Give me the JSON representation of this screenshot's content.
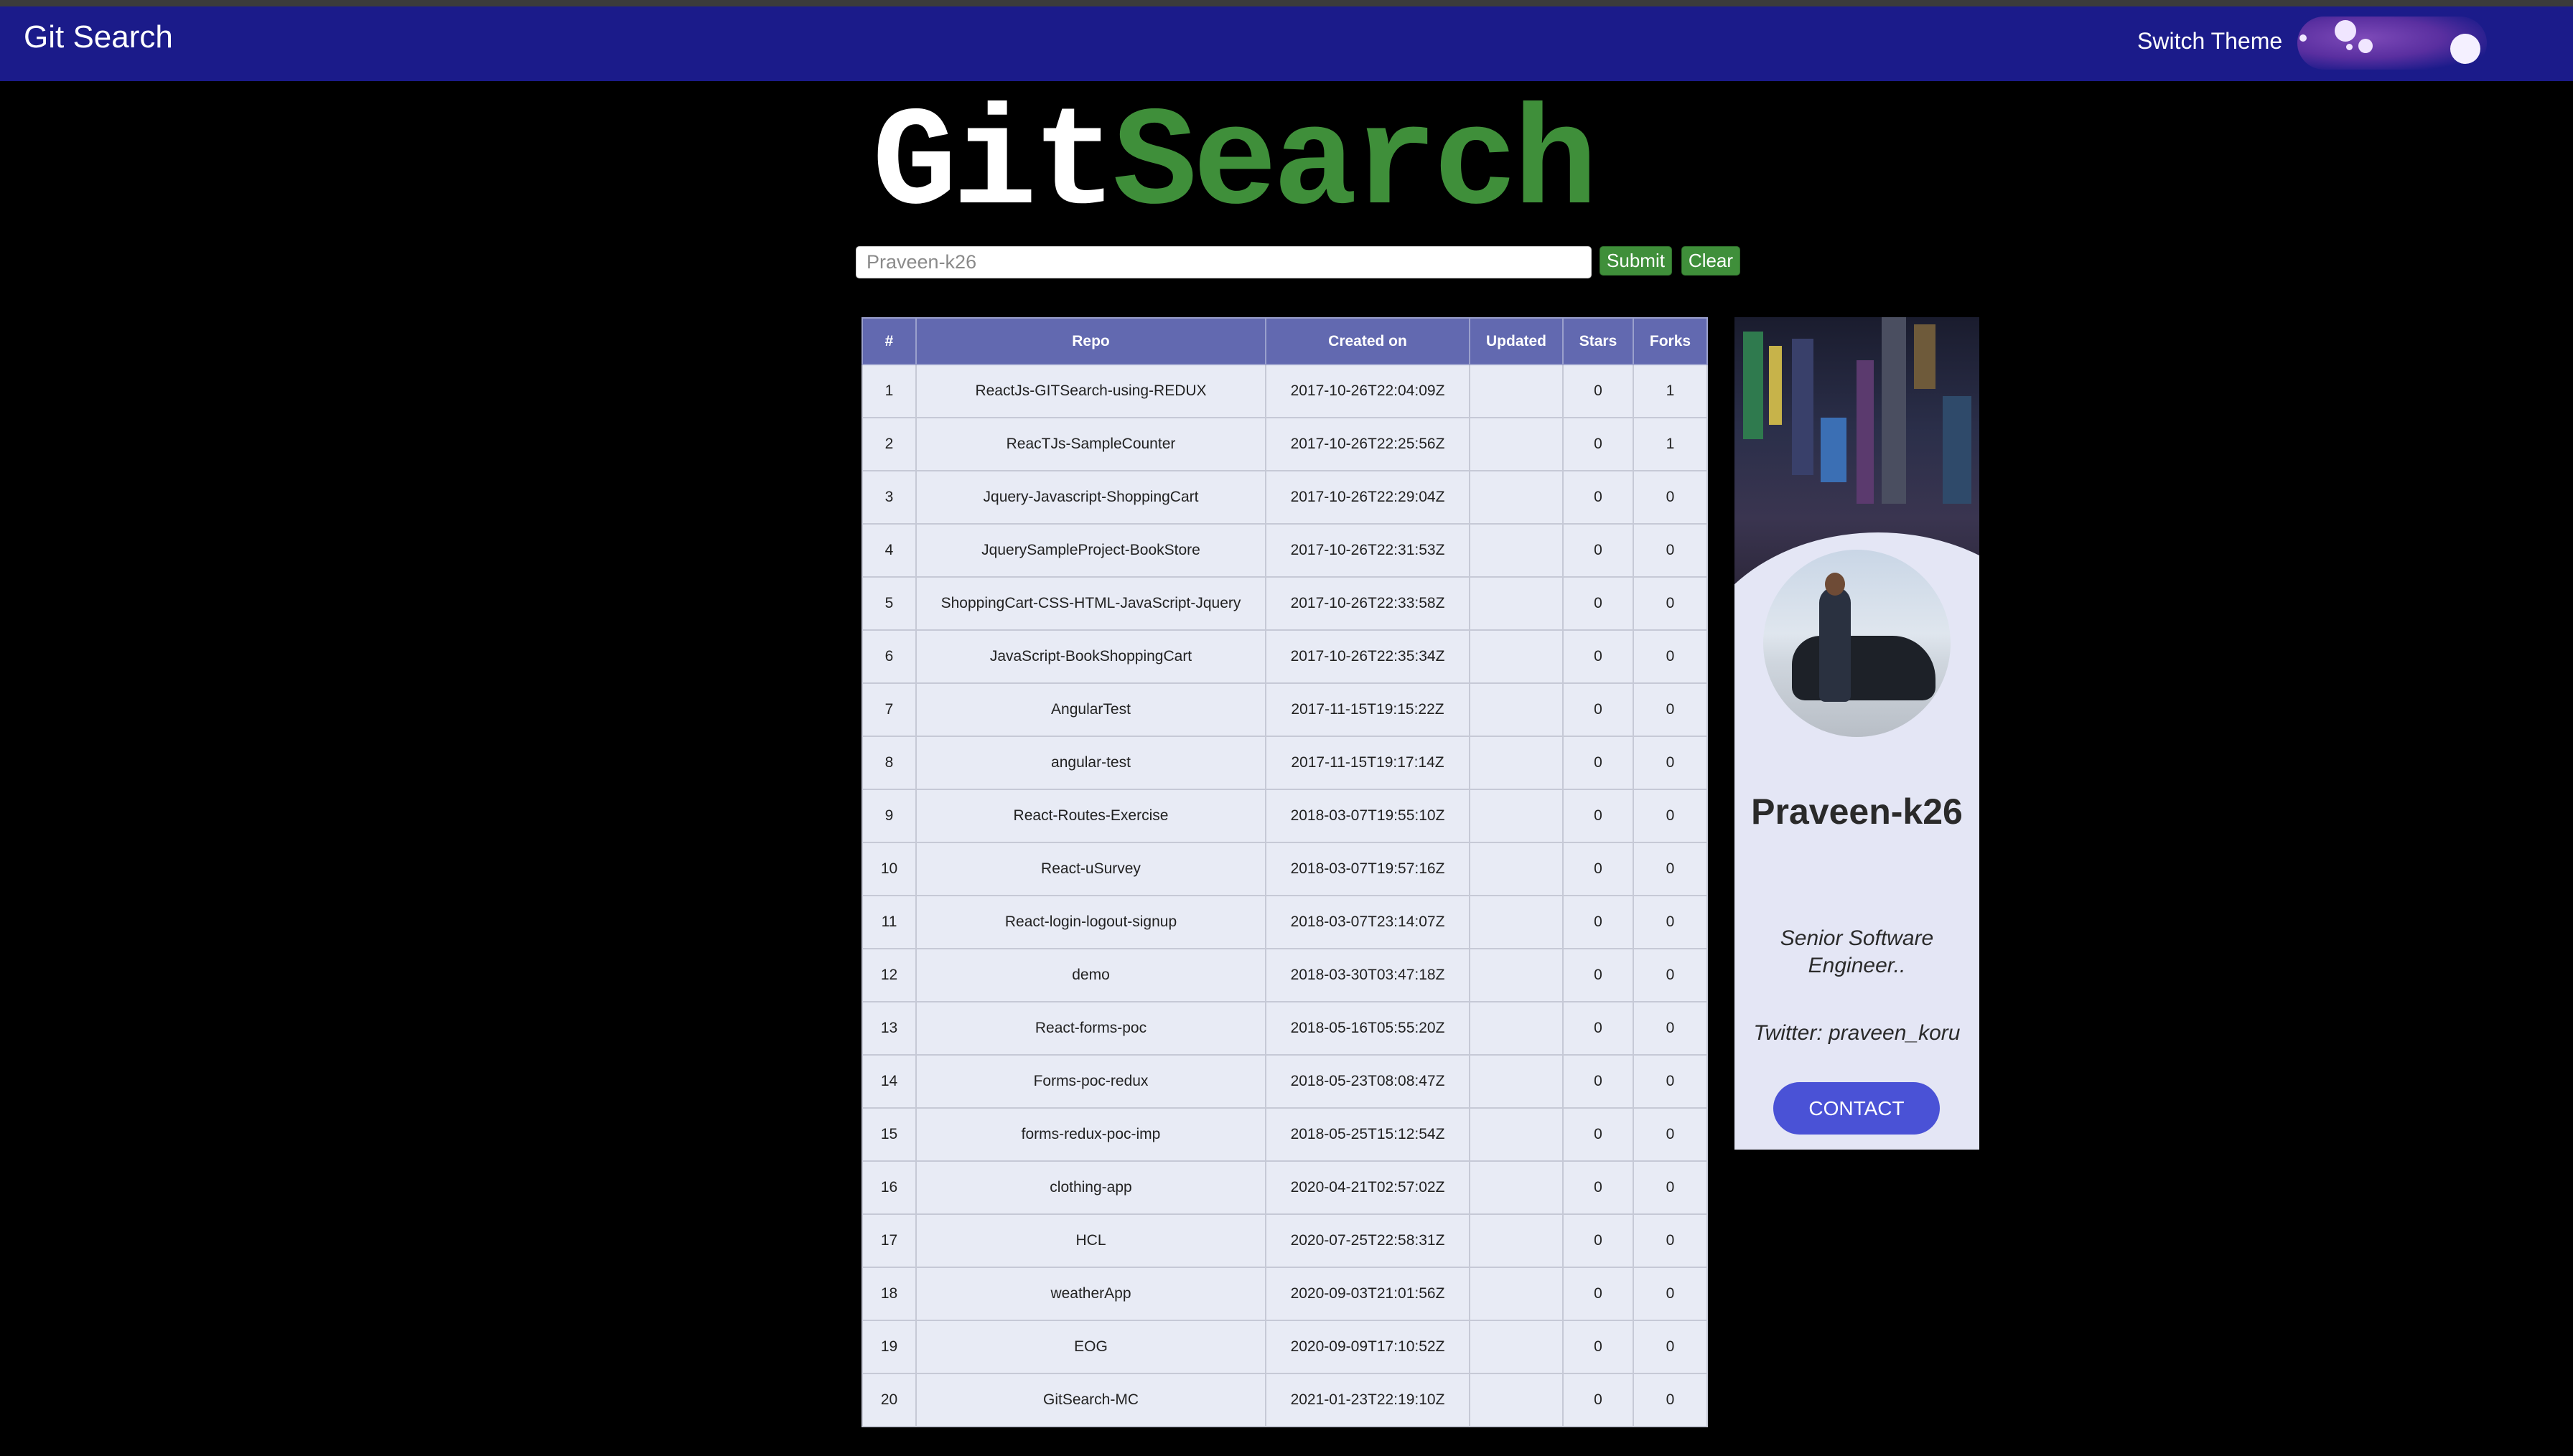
{
  "app": {
    "title": "Git Search"
  },
  "header": {
    "switch_theme_label": "Switch Theme"
  },
  "logo": {
    "part_a": "Git",
    "part_b": "Search"
  },
  "search": {
    "value": "",
    "placeholder": "Praveen-k26",
    "submit_label": "Submit",
    "clear_label": "Clear"
  },
  "table": {
    "columns": [
      "#",
      "Repo",
      "Created on",
      "Updated",
      "Stars",
      "Forks"
    ],
    "rows": [
      [
        "1",
        "ReactJs-GITSearch-using-REDUX",
        "2017-10-26T22:04:09Z",
        "",
        "0",
        "1"
      ],
      [
        "2",
        "ReacTJs-SampleCounter",
        "2017-10-26T22:25:56Z",
        "",
        "0",
        "1"
      ],
      [
        "3",
        "Jquery-Javascript-ShoppingCart",
        "2017-10-26T22:29:04Z",
        "",
        "0",
        "0"
      ],
      [
        "4",
        "JquerySampleProject-BookStore",
        "2017-10-26T22:31:53Z",
        "",
        "0",
        "0"
      ],
      [
        "5",
        "ShoppingCart-CSS-HTML-JavaScript-Jquery",
        "2017-10-26T22:33:58Z",
        "",
        "0",
        "0"
      ],
      [
        "6",
        "JavaScript-BookShoppingCart",
        "2017-10-26T22:35:34Z",
        "",
        "0",
        "0"
      ],
      [
        "7",
        "AngularTest",
        "2017-11-15T19:15:22Z",
        "",
        "0",
        "0"
      ],
      [
        "8",
        "angular-test",
        "2017-11-15T19:17:14Z",
        "",
        "0",
        "0"
      ],
      [
        "9",
        "React-Routes-Exercise",
        "2018-03-07T19:55:10Z",
        "",
        "0",
        "0"
      ],
      [
        "10",
        "React-uSurvey",
        "2018-03-07T19:57:16Z",
        "",
        "0",
        "0"
      ],
      [
        "11",
        "React-login-logout-signup",
        "2018-03-07T23:14:07Z",
        "",
        "0",
        "0"
      ],
      [
        "12",
        "demo",
        "2018-03-30T03:47:18Z",
        "",
        "0",
        "0"
      ],
      [
        "13",
        "React-forms-poc",
        "2018-05-16T05:55:20Z",
        "",
        "0",
        "0"
      ],
      [
        "14",
        "Forms-poc-redux",
        "2018-05-23T08:08:47Z",
        "",
        "0",
        "0"
      ],
      [
        "15",
        "forms-redux-poc-imp",
        "2018-05-25T15:12:54Z",
        "",
        "0",
        "0"
      ],
      [
        "16",
        "clothing-app",
        "2020-04-21T02:57:02Z",
        "",
        "0",
        "0"
      ],
      [
        "17",
        "HCL",
        "2020-07-25T22:58:31Z",
        "",
        "0",
        "0"
      ],
      [
        "18",
        "weatherApp",
        "2020-09-03T21:01:56Z",
        "",
        "0",
        "0"
      ],
      [
        "19",
        "EOG",
        "2020-09-09T17:10:52Z",
        "",
        "0",
        "0"
      ],
      [
        "20",
        "GitSearch-MC",
        "2021-01-23T22:19:10Z",
        "",
        "0",
        "0"
      ]
    ]
  },
  "profile": {
    "name": "Praveen-k26",
    "bio": "Senior Software Engineer..",
    "twitter": "Twitter: praveen_koru",
    "contact_label": "CONTACT"
  },
  "colors": {
    "navbar": "#1b1b8a",
    "logo_accent": "#3f8f3a",
    "button": "#3f8f3a",
    "table_header": "#6269b0",
    "table_cell": "#e8ebf5",
    "contact_button": "#4a52d6"
  }
}
